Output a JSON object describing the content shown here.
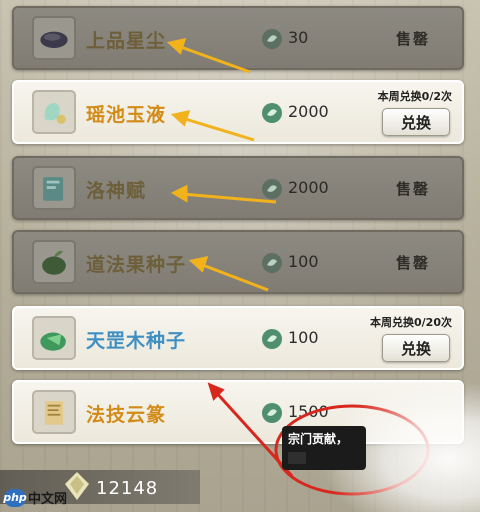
{
  "shop": {
    "items": [
      {
        "name": "上品星尘",
        "price": "30",
        "status": "售罄",
        "available": false
      },
      {
        "name": "瑶池玉液",
        "price": "2000",
        "limit": "本周兑换0/2次",
        "button": "兑换",
        "available": true
      },
      {
        "name": "洛神赋",
        "price": "2000",
        "status": "售罄",
        "available": false
      },
      {
        "name": "道法果种子",
        "price": "100",
        "status": "售罄",
        "available": false
      },
      {
        "name": "天罡木种子",
        "price": "100",
        "limit": "本周兑换0/20次",
        "button": "兑换",
        "available": true
      },
      {
        "name": "法技云篆",
        "price": "1500",
        "available": true
      }
    ]
  },
  "currency": {
    "value": "12148",
    "icon": "jade-leaf-icon"
  },
  "tooltip": {
    "text": "宗门贡献，"
  },
  "watermark": {
    "logo": "php",
    "text": "中文网"
  },
  "colors": {
    "gold_name": "#d38b17",
    "blue_name": "#3f8fc2",
    "arrow": "#f2b21b",
    "annotation": "#d8281e"
  }
}
